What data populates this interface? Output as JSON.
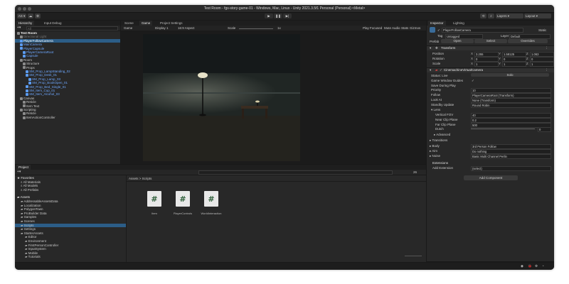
{
  "window": {
    "title": "Test Room - fgs-story-game-01 - Windows, Mac, Linux - Unity 2021.3.5f1 Personal (Personal) <Metal>"
  },
  "toolbar": {
    "account": "AS ▾",
    "layers": "Layers",
    "layout": "Layout"
  },
  "hierarchy": {
    "tabs": [
      "Hierarchy",
      "Input Debug"
    ],
    "search_placeholder": "All",
    "items": [
      {
        "label": "Test Room",
        "indent": 0,
        "style": "bold"
      },
      {
        "label": "Directional Light",
        "indent": 2,
        "style": "dim"
      },
      {
        "label": "PlayerFollowCamera",
        "indent": 2,
        "style": "selected"
      },
      {
        "label": "MainCamera",
        "indent": 2,
        "style": "blue"
      },
      {
        "label": "PlayerCapsule",
        "indent": 2,
        "style": "blue"
      },
      {
        "label": "PlayerCameraRoot",
        "indent": 4,
        "style": "blue"
      },
      {
        "label": "Capsule",
        "indent": 4,
        "style": "blue"
      },
      {
        "label": "Room",
        "indent": 2,
        "style": "normal"
      },
      {
        "label": "Structure",
        "indent": 4,
        "style": "normal"
      },
      {
        "label": "Props",
        "indent": 4,
        "style": "normal"
      },
      {
        "label": "SM_Prop_LampStanding_02",
        "indent": 6,
        "style": "blue"
      },
      {
        "label": "SM_Prop_Desk_01",
        "indent": 6,
        "style": "blue"
      },
      {
        "label": "SM_Prop_Lamp_03",
        "indent": 8,
        "style": "blue"
      },
      {
        "label": "SM_Prop_BookOpen_01",
        "indent": 8,
        "style": "blue"
      },
      {
        "label": "SM_Prop_Bed_Single_01",
        "indent": 6,
        "style": "blue"
      },
      {
        "label": "SM_Item_Cup_01",
        "indent": 6,
        "style": "blue"
      },
      {
        "label": "SM_Item_Alcohol_03",
        "indent": 6,
        "style": "blue"
      },
      {
        "label": "Canvas",
        "indent": 2,
        "style": "normal"
      },
      {
        "label": "Reticle",
        "indent": 4,
        "style": "normal"
      },
      {
        "label": "Item Text",
        "indent": 4,
        "style": "normal"
      },
      {
        "label": "Scripting",
        "indent": 2,
        "style": "normal"
      },
      {
        "label": "Reticle",
        "indent": 4,
        "style": "normal"
      },
      {
        "label": "ItemActionController",
        "indent": 4,
        "style": "normal"
      }
    ]
  },
  "scene": {
    "tabs": [
      "Scene",
      "Game",
      "Project Settings"
    ],
    "display": "Display 1",
    "aspect": "16:9 Aspect",
    "scale_label": "Scale",
    "scale_value": "1x",
    "play_focused": "Play Focused",
    "mute_audio": "Mute Audio",
    "stats": "Stats",
    "gizmos": "Gizmos"
  },
  "project": {
    "tab": "Project",
    "favorites_label": "Favorites",
    "favorites": [
      "All Materials",
      "All Models",
      "All Prefabs"
    ],
    "assets_label": "Assets",
    "folders": [
      "AddressableAssetsData",
      "Localization",
      "PolygonTown",
      "ProBuilder Data",
      "Samples",
      "Scenes",
      "Scripts",
      "Settings",
      "StarterAssets",
      "Editor",
      "Environment",
      "FirstPersonController",
      "InputSystem",
      "Mobile",
      "Tutorials"
    ],
    "breadcrumb": "Assets > Scripts",
    "files": [
      "Item",
      "PlayerControls",
      "WorldInteraction"
    ],
    "count": "26"
  },
  "inspector": {
    "tabs": [
      "Inspector",
      "Lighting"
    ],
    "object_name": "PlayerFollowCamera",
    "static_label": "Static",
    "tag_label": "Tag",
    "tag_value": "Untagged",
    "layer_label": "Layer",
    "layer_value": "Default",
    "prefab_label": "Prefab",
    "prefab_open": "Open",
    "prefab_select": "Select",
    "prefab_overrides": "Overrides",
    "transform_label": "Transform",
    "position_label": "Position",
    "position": [
      "3.255",
      "1.58125",
      "1.063"
    ],
    "rotation_label": "Rotation",
    "rotation": [
      "0",
      "0",
      "0"
    ],
    "scale_label": "Scale",
    "scale": [
      "1",
      "1",
      "1"
    ],
    "vcam_label": "CinemachineVirtualCamera",
    "props": [
      {
        "label": "Status: Live",
        "value": "Solo"
      },
      {
        "label": "Game Window Guides",
        "value": "✓"
      },
      {
        "label": "Save During Play",
        "value": ""
      },
      {
        "label": "Priority",
        "value": "10"
      },
      {
        "label": "Follow",
        "value": "PlayerCameraRoot (Transform)"
      },
      {
        "label": "Look At",
        "value": "None (Transform)"
      },
      {
        "label": "Standby Update",
        "value": "Round Robin"
      }
    ],
    "lens_label": "Lens",
    "lens": [
      {
        "label": "Vertical FOV",
        "value": "40"
      },
      {
        "label": "Near Clip Plane",
        "value": "0.2"
      },
      {
        "label": "Far Clip Plane",
        "value": "500"
      },
      {
        "label": "Dutch",
        "value": "0"
      }
    ],
    "advanced_label": "Advanced",
    "transitions_label": "Transitions",
    "body_label": "Body",
    "body_value": "3rd Person Follow",
    "aim_label": "Aim",
    "aim_value": "Do nothing",
    "noise_label": "Noise",
    "noise_value": "Basic Multi Channel Perlin",
    "extensions_label": "Extensions",
    "add_extension_label": "Add Extension",
    "add_extension_value": "(select)",
    "add_component": "Add Component"
  },
  "colors": {
    "accent": "#2c5d87",
    "prefab_blue": "#6ea8ff",
    "panel": "#282828",
    "titlebar": "#2a2a2a"
  }
}
